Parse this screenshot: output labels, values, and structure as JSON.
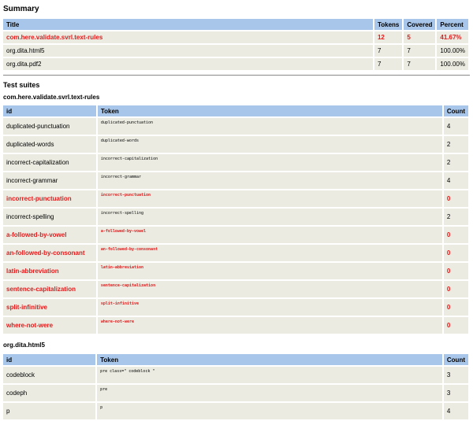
{
  "summary": {
    "heading": "Summary",
    "columns": [
      "Title",
      "Tokens",
      "Covered",
      "Percent"
    ],
    "rows": [
      {
        "title": "com.here.validate.svrl.text-rules",
        "tokens": "12",
        "covered": "5",
        "percent": "41.67%"
      },
      {
        "title": "org.dita.html5",
        "tokens": "7",
        "covered": "7",
        "percent": "100.00%"
      },
      {
        "title": "org.dita.pdf2",
        "tokens": "7",
        "covered": "7",
        "percent": "100.00%"
      }
    ]
  },
  "test_suites": {
    "heading": "Test suites",
    "suites": [
      {
        "name": "com.here.validate.svrl.text-rules",
        "columns": [
          "id",
          "Token",
          "Count"
        ],
        "rows": [
          {
            "id": "duplicated-punctuation",
            "token": "duplicated-punctuation",
            "count": "4"
          },
          {
            "id": "duplicated-words",
            "token": "duplicated-words",
            "count": "2"
          },
          {
            "id": "incorrect-capitalization",
            "token": "incorrect-capitalization",
            "count": "2"
          },
          {
            "id": "incorrect-grammar",
            "token": "incorrect-grammar",
            "count": "4"
          },
          {
            "id": "incorrect-punctuation",
            "token": "incorrect-punctuation",
            "count": "0"
          },
          {
            "id": "incorrect-spelling",
            "token": "incorrect-spelling",
            "count": "2"
          },
          {
            "id": "a-followed-by-vowel",
            "token": "a-followed-by-vowel",
            "count": "0"
          },
          {
            "id": "an-followed-by-consonant",
            "token": "an-followed-by-consonant",
            "count": "0"
          },
          {
            "id": "latin-abbreviation",
            "token": "latin-abbreviation",
            "count": "0"
          },
          {
            "id": "sentence-capitalization",
            "token": "sentence-capitalization",
            "count": "0"
          },
          {
            "id": "split-infinitive",
            "token": "split-infinitive",
            "count": "0"
          },
          {
            "id": "where-not-were",
            "token": "where-not-were",
            "count": "0"
          }
        ]
      },
      {
        "name": "org.dita.html5",
        "columns": [
          "id",
          "Token",
          "Count"
        ],
        "rows": [
          {
            "id": "codeblock",
            "token": "pre class=\" codeblock \"",
            "count": "3"
          },
          {
            "id": "codeph",
            "token": "pre",
            "count": "3"
          },
          {
            "id": "p",
            "token": "p",
            "count": "4"
          }
        ]
      }
    ]
  },
  "colors": {
    "header_bg": "#a8c6ea",
    "row_bg": "#ebebe2",
    "fail": "#e21b1b"
  }
}
